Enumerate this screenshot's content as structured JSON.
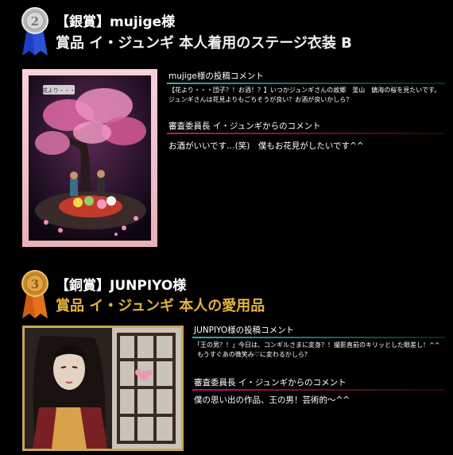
{
  "sections": [
    {
      "medal": "silver-medal-2",
      "rank_line": "【銀賞】mujige様",
      "prize_line": "賞品 イ・ジュンギ 本人着用のステージ衣装 B",
      "image_caption": "花より・・・",
      "poster_heading": "mujige様の投稿コメント",
      "poster_comment_1": "【花より・・・団子？！お酒！？】いつかジュンギさんの故郷　釜山　鎮海の桜を見たいです。",
      "poster_comment_2": "ジュンギさんは花見よりもごちそうが良い？お酒が良いかしら？",
      "judge_heading": "審査委員長 イ・ジュンギからのコメント",
      "judge_comment": "お酒がいいです…(笑)　僕もお花見がしたいです^^"
    },
    {
      "medal": "bronze-medal-3",
      "rank_line": "【銅賞】JUNPIYO様",
      "prize_line": "賞品 イ・ジュンギ 本人の愛用品",
      "poster_heading": "JUNPIYO様の投稿コメント",
      "poster_comment_1": "「王の男？！」今日は、コンギルさまに変身？！撮影直前のキリッとした眼差し！^^",
      "poster_comment_2": "もうすぐあの微笑み♡に変わるかしら？",
      "judge_heading": "審査委員長 イ・ジュンギからのコメント",
      "judge_comment": "僕の思い出の作品、王の男！芸術的〜^^"
    }
  ],
  "colors": {
    "silver_title": "#f0f0f0",
    "gold_title": "#e3b33c",
    "teal_line": "#2fb3b6",
    "pink_line": "#c0166b",
    "gold_frame": "#c9a65a",
    "pink_frame": "#f3c3c9"
  }
}
